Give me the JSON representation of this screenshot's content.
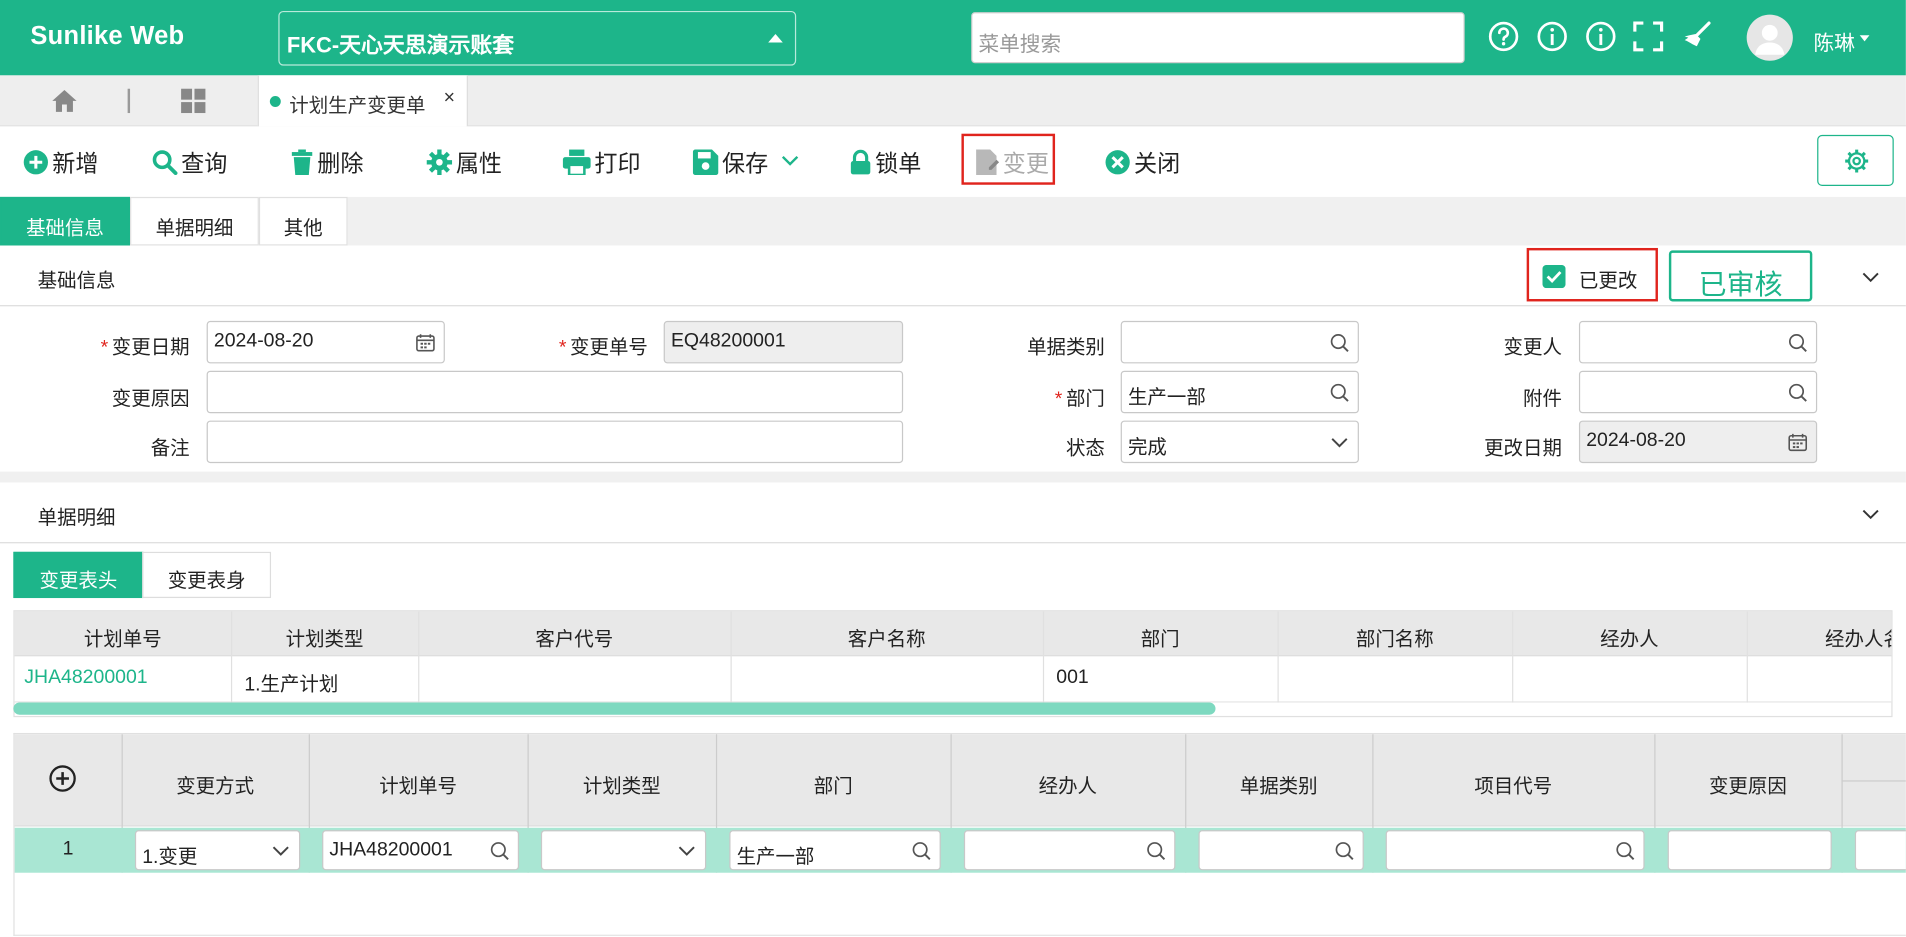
{
  "header": {
    "logo": "Sunlike Web",
    "account": "FKC-天心天思演示账套",
    "search_placeholder": "菜单搜索",
    "icons": [
      "help-icon",
      "info-icon",
      "info-icon",
      "fullscreen-icon",
      "broom-icon"
    ],
    "user_name": "陈琳"
  },
  "tabs": {
    "home_icon": "home-icon",
    "apps_icon": "grid-icon",
    "open_tab": "计划生产变更单",
    "close_glyph": "×"
  },
  "toolbar": {
    "new": "新增",
    "query": "查询",
    "delete": "删除",
    "properties": "属性",
    "print": "打印",
    "save": "保存",
    "lock": "锁单",
    "change": "变更",
    "close": "关闭"
  },
  "section_tabs": [
    "基础信息",
    "单据明细",
    "其他"
  ],
  "basic": {
    "title": "基础信息",
    "modified_label": "已更改",
    "modified_checked": true,
    "audit_badge": "已审核",
    "fields": {
      "change_date_label": "变更日期",
      "change_date": "2024-08-20",
      "change_no_label": "变更单号",
      "change_no": "EQ48200001",
      "doc_type_label": "单据类别",
      "doc_type": "",
      "changer_label": "变更人",
      "changer": "",
      "reason_label": "变更原因",
      "reason": "",
      "dept_label": "部门",
      "dept": "生产一部",
      "attach_label": "附件",
      "attach": "",
      "remark_label": "备注",
      "remark": "",
      "status_label": "状态",
      "status": "完成",
      "modify_date_label": "更改日期",
      "modify_date": "2024-08-20"
    }
  },
  "detail": {
    "title": "单据明细",
    "sub_tabs": [
      "变更表头",
      "变更表身"
    ],
    "header_grid": {
      "columns": [
        "计划单号",
        "计划类型",
        "客户代号",
        "客户名称",
        "部门",
        "部门名称",
        "经办人",
        "经办人名"
      ],
      "row": [
        "JHA48200001",
        "1.生产计划",
        "",
        "",
        "001",
        "",
        "",
        ""
      ]
    },
    "body_grid": {
      "columns": [
        "变更方式",
        "计划单号",
        "计划类型",
        "部门",
        "经办人",
        "单据类别",
        "项目代号",
        "变更原因"
      ],
      "row": {
        "no": "1",
        "method": "1.变更",
        "plan_no": "JHA48200001",
        "plan_type": "",
        "dept": "生产一部",
        "handler": "",
        "doc_type": "",
        "project": "",
        "reason": ""
      }
    }
  }
}
